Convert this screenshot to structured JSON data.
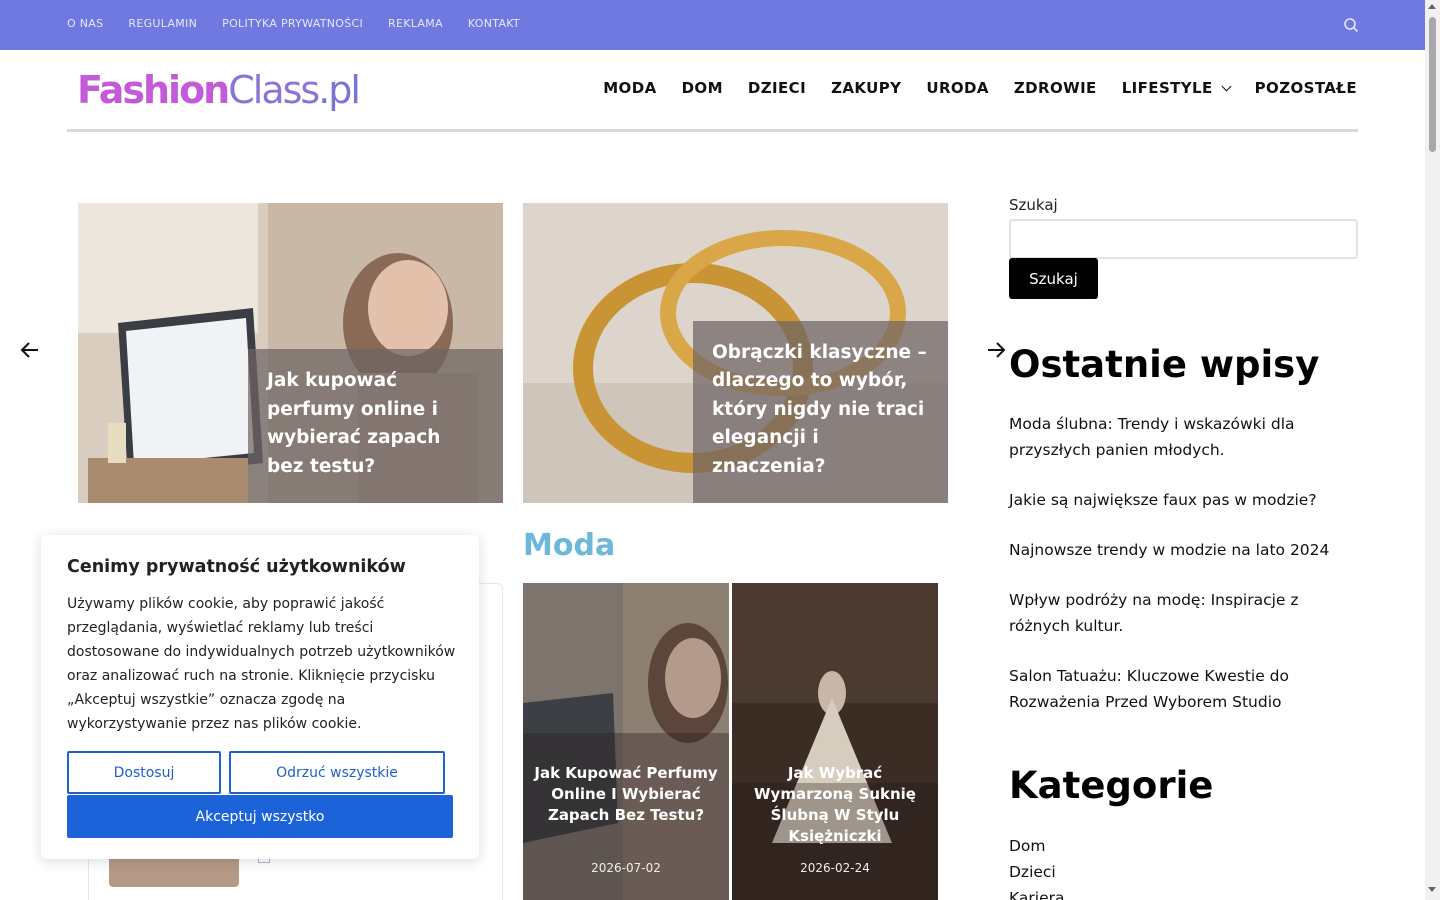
{
  "top_nav": [
    "O NAS",
    "REGULAMIN",
    "POLITYKA PRYWATNOŚCI",
    "REKLAMA",
    "KONTAKT"
  ],
  "logo": {
    "part1": "Fashion",
    "part2": "Class",
    "part3": ".pl"
  },
  "main_nav": [
    "MODA",
    "DOM",
    "DZIECI",
    "ZAKUPY",
    "URODA",
    "ZDROWIE",
    "LIFESTYLE",
    "POZOSTAŁE"
  ],
  "slider": [
    {
      "title": "Jak kupować perfumy online i wybierać zapach bez testu?"
    },
    {
      "title": "Obrączki klasyczne – dlaczego to wybór, który nigdy nie traci elegancji i znaczenia?"
    }
  ],
  "moda": {
    "title": "Moda",
    "cards": [
      {
        "title": "Jak Kupować Perfumy Online I Wybierać Zapach Bez Testu?",
        "date": "2026-07-02"
      },
      {
        "title": "Jak Wybrać Wymarzoną Suknię Ślubną W Stylu Księżniczki",
        "date": "2026-02-24"
      }
    ]
  },
  "sidebar": {
    "search_label": "Szukaj",
    "search_value": "",
    "search_button": "Szukaj",
    "recent_title": "Ostatnie wpisy",
    "recent": [
      "Moda ślubna: Trendy i wskazówki dla przyszłych panien młodych.",
      "Jakie są największe faux pas w modzie?",
      "Najnowsze trendy w modzie na lato 2024",
      "Wpływ podróży na modę: Inspiracje z różnych kultur.",
      "Salon Tatuażu: Kluczowe Kwestie do Rozważenia Przed Wyborem Studio"
    ],
    "categories_title": "Kategorie",
    "categories": [
      "Dom",
      "Dzieci",
      "Kariera"
    ]
  },
  "cookie": {
    "title": "Cenimy prywatność użytkowników",
    "text": "Używamy plików cookie, aby poprawić jakość przeglądania, wyświetlać reklamy lub treści dostosowane do indywidualnych potrzeb użytkowników oraz analizować ruch na stronie. Kliknięcie przycisku „Akceptuj wszystkie” oznacza zgodę na wykorzystywanie przez nas plików cookie.",
    "customize": "Dostosuj",
    "reject": "Odrzuć wszystkie",
    "accept": "Akceptuj wszystko"
  },
  "colors": {
    "topbar": "#7079df",
    "accent_blue": "#1c63da",
    "moda_title": "#6cb7da"
  },
  "icons": [
    "search-icon",
    "arrow-left-icon",
    "arrow-right-icon",
    "chevron-down-icon"
  ]
}
